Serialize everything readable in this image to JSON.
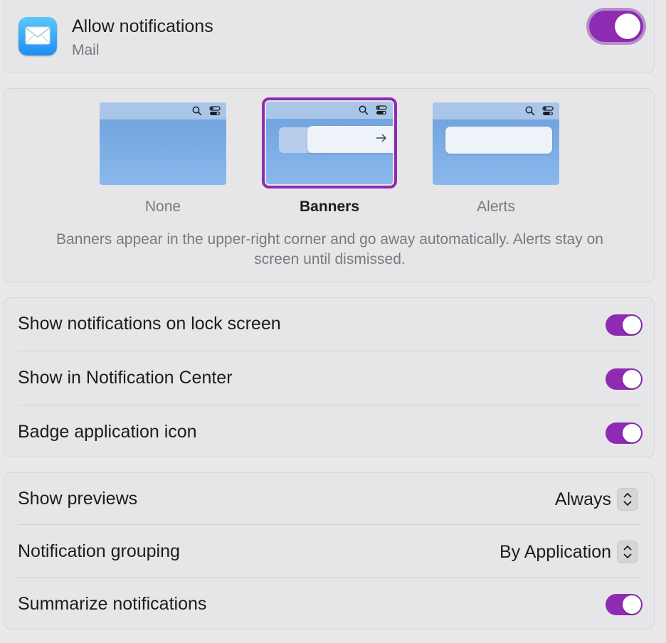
{
  "app": {
    "allow_label": "Allow notifications",
    "app_name": "Mail",
    "allow_enabled": true,
    "icon": "mail-envelope-icon"
  },
  "alert_style": {
    "options": [
      {
        "label": "None",
        "selected": false
      },
      {
        "label": "Banners",
        "selected": true
      },
      {
        "label": "Alerts",
        "selected": false
      }
    ],
    "description": "Banners appear in the upper-right corner and go away automatically. Alerts stay on screen until dismissed."
  },
  "toggles": [
    {
      "label": "Show notifications on lock screen",
      "on": true
    },
    {
      "label": "Show in Notification Center",
      "on": true
    },
    {
      "label": "Badge application icon",
      "on": true
    }
  ],
  "prefs": {
    "show_previews": {
      "label": "Show previews",
      "value": "Always"
    },
    "grouping": {
      "label": "Notification grouping",
      "value": "By Application"
    },
    "summarize": {
      "label": "Summarize notifications",
      "on": true
    }
  },
  "colors": {
    "accent": "#8e2bb2",
    "background": "#e9e9eb",
    "card": "#e6e6e8",
    "secondary_text": "#7a7a7e"
  }
}
